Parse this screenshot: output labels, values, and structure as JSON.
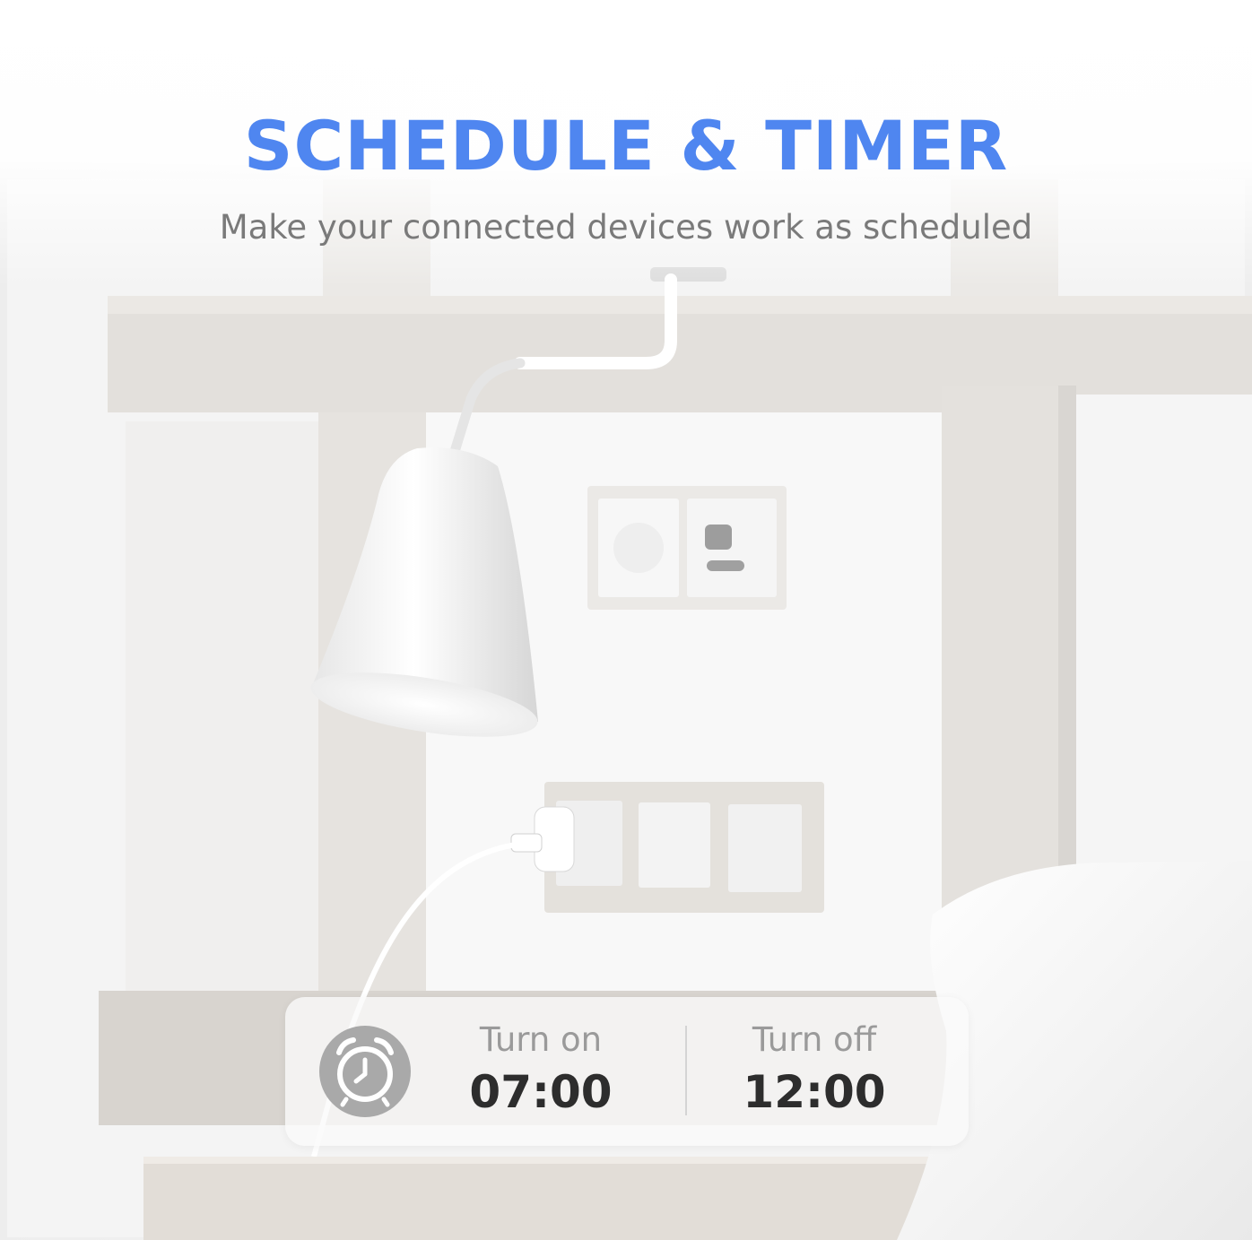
{
  "header": {
    "title": "SCHEDULE & TIMER",
    "subtitle": "Make your connected devices work as scheduled"
  },
  "timer": {
    "icon": "stopwatch-icon",
    "on": {
      "label": "Turn on",
      "time": "07:00"
    },
    "off": {
      "label": "Turn off",
      "time": "12:00"
    }
  },
  "colors": {
    "accent": "#4f86f0",
    "icon_circle": "#a9a9a9",
    "label_text": "#9a9a9a",
    "time_text": "#2d2d2d"
  }
}
